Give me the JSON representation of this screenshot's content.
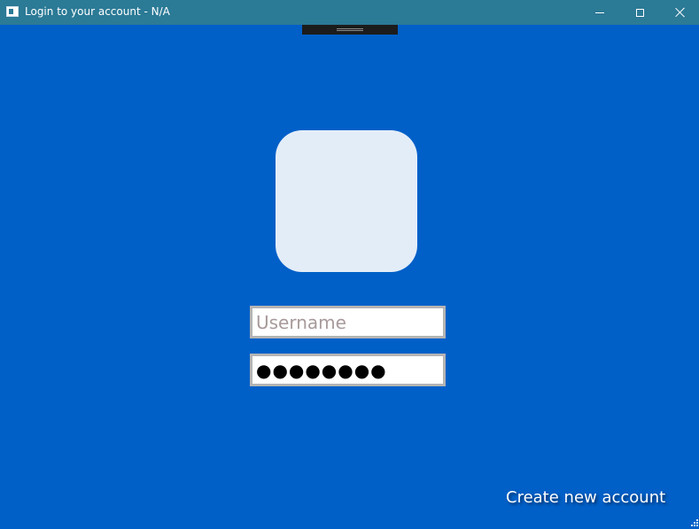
{
  "window": {
    "title": "Login to your account - N/A",
    "icons": {
      "app": "window-app-icon",
      "minimize": "minimize-icon",
      "maximize": "maximize-icon",
      "close": "close-icon"
    }
  },
  "colors": {
    "background": "#0060c8",
    "titlebar": "#2b7a96",
    "avatar": "#e3edf8",
    "field_border": "#b4b4b4"
  },
  "login": {
    "username": {
      "value": "",
      "placeholder": "Username"
    },
    "password": {
      "masked_value": "●●●●●●●●"
    },
    "create_account_label": "Create new account"
  }
}
